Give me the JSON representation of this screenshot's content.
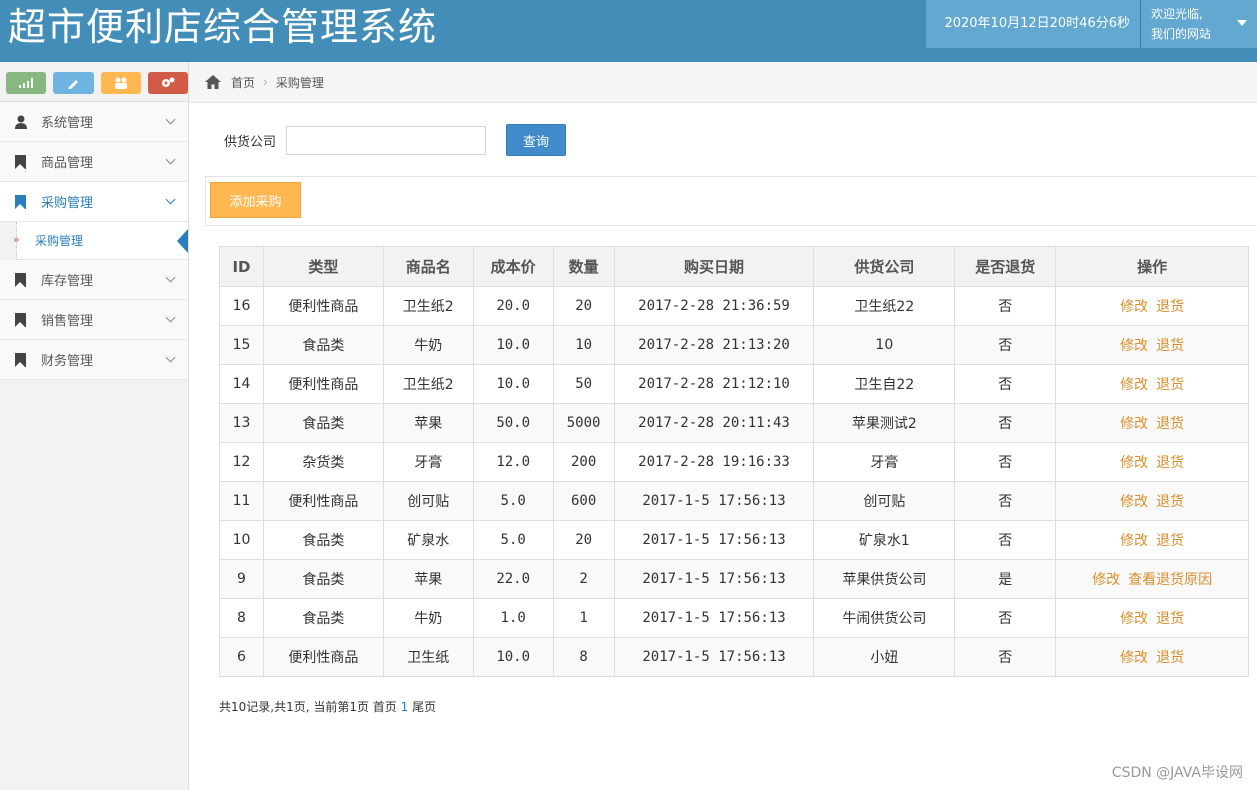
{
  "header": {
    "title": "超市便利店综合管理系统",
    "clock": "2020年10月12日20时46分6秒",
    "welcome_line1": "欢迎光临,",
    "welcome_line2": "我们的网站"
  },
  "sidebar": {
    "items": [
      {
        "label": "系统管理",
        "icon": "user-icon"
      },
      {
        "label": "商品管理",
        "icon": "bookmark-icon"
      },
      {
        "label": "采购管理",
        "icon": "bookmark-icon"
      },
      {
        "label": "库存管理",
        "icon": "bookmark-icon"
      },
      {
        "label": "销售管理",
        "icon": "bookmark-icon"
      },
      {
        "label": "财务管理",
        "icon": "bookmark-icon"
      }
    ],
    "sub_item": "采购管理",
    "shortcut_colors": [
      "#87b87f",
      "#6fb3e0",
      "#ffb752",
      "#d15b47"
    ]
  },
  "breadcrumb": {
    "home": "首页",
    "current": "采购管理"
  },
  "search": {
    "label": "供货公司",
    "value": "",
    "button": "查询"
  },
  "add_button": "添加采购",
  "table": {
    "headers": [
      "ID",
      "类型",
      "商品名",
      "成本价",
      "数量",
      "购买日期",
      "供货公司",
      "是否退货",
      "操作"
    ],
    "rows": [
      {
        "id": "16",
        "type": "便利性商品",
        "name": "卫生纸2",
        "cost": "20.0",
        "qty": "20",
        "date": "2017-2-28 21:36:59",
        "supplier": "卫生纸22",
        "returned": "否",
        "op1": "修改",
        "op2": "退货"
      },
      {
        "id": "15",
        "type": "食品类",
        "name": "牛奶",
        "cost": "10.0",
        "qty": "10",
        "date": "2017-2-28 21:13:20",
        "supplier": "10",
        "returned": "否",
        "op1": "修改",
        "op2": "退货"
      },
      {
        "id": "14",
        "type": "便利性商品",
        "name": "卫生纸2",
        "cost": "10.0",
        "qty": "50",
        "date": "2017-2-28 21:12:10",
        "supplier": "卫生自22",
        "returned": "否",
        "op1": "修改",
        "op2": "退货"
      },
      {
        "id": "13",
        "type": "食品类",
        "name": "苹果",
        "cost": "50.0",
        "qty": "5000",
        "date": "2017-2-28 20:11:43",
        "supplier": "苹果测试2",
        "returned": "否",
        "op1": "修改",
        "op2": "退货"
      },
      {
        "id": "12",
        "type": "杂货类",
        "name": "牙膏",
        "cost": "12.0",
        "qty": "200",
        "date": "2017-2-28 19:16:33",
        "supplier": "牙膏",
        "returned": "否",
        "op1": "修改",
        "op2": "退货"
      },
      {
        "id": "11",
        "type": "便利性商品",
        "name": "创可贴",
        "cost": "5.0",
        "qty": "600",
        "date": "2017-1-5 17:56:13",
        "supplier": "创可贴",
        "returned": "否",
        "op1": "修改",
        "op2": "退货"
      },
      {
        "id": "10",
        "type": "食品类",
        "name": "矿泉水",
        "cost": "5.0",
        "qty": "20",
        "date": "2017-1-5 17:56:13",
        "supplier": "矿泉水1",
        "returned": "否",
        "op1": "修改",
        "op2": "退货"
      },
      {
        "id": "9",
        "type": "食品类",
        "name": "苹果",
        "cost": "22.0",
        "qty": "2",
        "date": "2017-1-5 17:56:13",
        "supplier": "苹果供货公司",
        "returned": "是",
        "op1": "修改",
        "op2": "查看退货原因"
      },
      {
        "id": "8",
        "type": "食品类",
        "name": "牛奶",
        "cost": "1.0",
        "qty": "1",
        "date": "2017-1-5 17:56:13",
        "supplier": "牛闹供货公司",
        "returned": "否",
        "op1": "修改",
        "op2": "退货"
      },
      {
        "id": "6",
        "type": "便利性商品",
        "name": "卫生纸",
        "cost": "10.0",
        "qty": "8",
        "date": "2017-1-5 17:56:13",
        "supplier": "小妞",
        "returned": "否",
        "op1": "修改",
        "op2": "退货"
      }
    ]
  },
  "pager": {
    "summary": "共10记录,共1页, 当前第1页 首页",
    "current_page": "1",
    "last": "尾页"
  },
  "watermark": "CSDN @JAVA毕设网"
}
